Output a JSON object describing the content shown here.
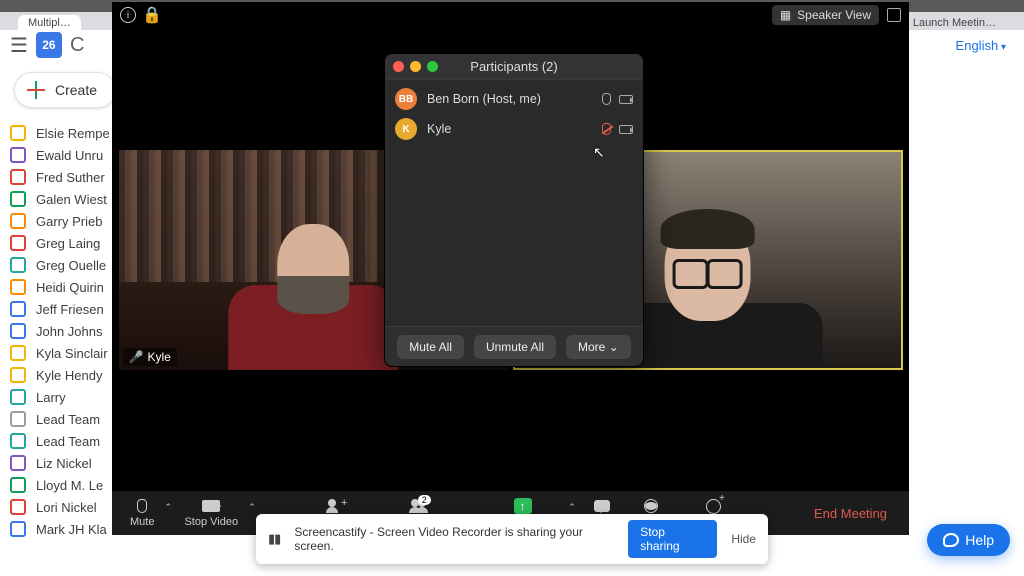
{
  "browser": {
    "left_tab": "Multipl…",
    "right_tab": "Launch Meetin…"
  },
  "gcal": {
    "logo_day": "26",
    "title_initial": "C",
    "language": "English",
    "create": "Create",
    "calendars": [
      {
        "name": "Elsie Rempe",
        "color": "c-yellow"
      },
      {
        "name": "Ewald Unru",
        "color": "c-purple"
      },
      {
        "name": "Fred Suther",
        "color": "c-red"
      },
      {
        "name": "Galen Wiest",
        "color": "c-green"
      },
      {
        "name": "Garry Prieb",
        "color": "c-orange"
      },
      {
        "name": "Greg Laing",
        "color": "c-red"
      },
      {
        "name": "Greg Ouelle",
        "color": "c-teal"
      },
      {
        "name": "Heidi Quirin",
        "color": "c-orange"
      },
      {
        "name": "Jeff Friesen",
        "color": "c-blue"
      },
      {
        "name": "John Johns",
        "color": "c-blue"
      },
      {
        "name": "Kyla Sinclair",
        "color": "c-yellow"
      },
      {
        "name": "Kyle Hendy",
        "color": "c-yellow"
      },
      {
        "name": "Larry",
        "color": "c-teal"
      },
      {
        "name": "Lead Team",
        "color": "c-grey"
      },
      {
        "name": "Lead Team",
        "color": "c-teal"
      },
      {
        "name": "Liz Nickel",
        "color": "c-purple"
      },
      {
        "name": "Lloyd M. Le",
        "color": "c-green"
      },
      {
        "name": "Lori Nickel",
        "color": "c-red"
      },
      {
        "name": "Mark JH Kla",
        "color": "c-blue"
      }
    ]
  },
  "zoom": {
    "speaker_view": "Speaker View",
    "tile_name_left": "Kyle",
    "toolbar": {
      "mute": "Mute",
      "stop_video": "Stop Video",
      "invite": "Invite",
      "manage": "Manage Participants",
      "manage_count": "2",
      "share": "Share Screen",
      "chat": "Chat",
      "record": "Record",
      "reactions": "Reactions",
      "end": "End Meeting"
    }
  },
  "participants": {
    "title": "Participants (2)",
    "rows": [
      {
        "initials": "BB",
        "name": "Ben Born (Host, me)",
        "avatar": "av-o",
        "muted": false
      },
      {
        "initials": "K",
        "name": "Kyle",
        "avatar": "av-y",
        "muted": true
      }
    ],
    "mute_all": "Mute All",
    "unmute_all": "Unmute All",
    "more": "More"
  },
  "castify": {
    "text": "Screencastify - Screen Video Recorder is sharing your screen.",
    "stop": "Stop sharing",
    "hide": "Hide"
  },
  "help": "Help"
}
